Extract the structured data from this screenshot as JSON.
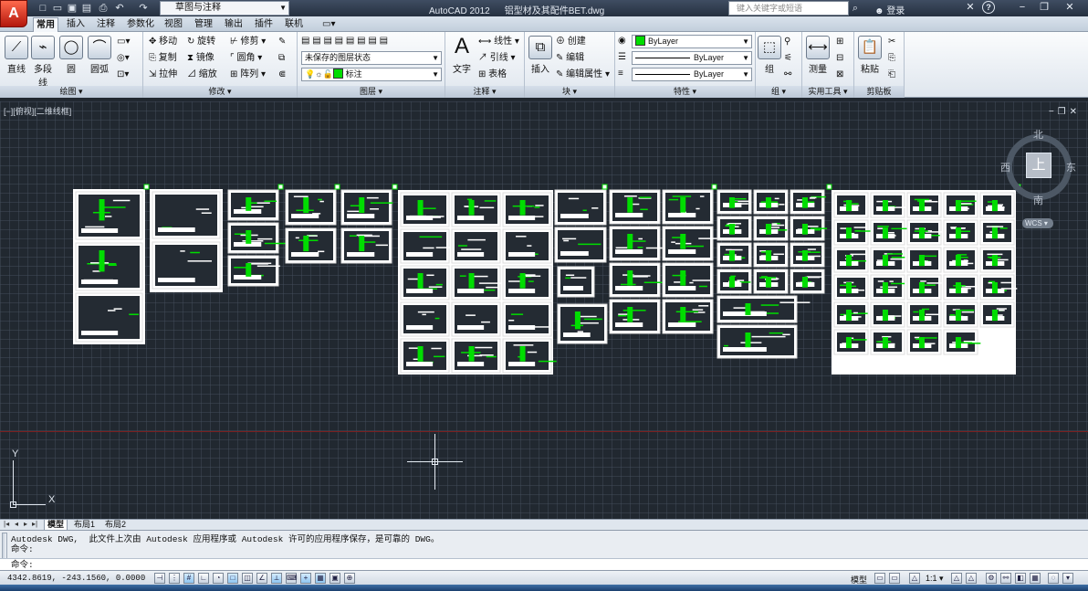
{
  "app": {
    "logo": "A",
    "title": "AutoCAD 2012",
    "file": "铝型材及其配件BET.dwg"
  },
  "quick_access": [
    "new-icon",
    "open-icon",
    "save-icon",
    "saveas-icon",
    "print-icon",
    "undo-icon",
    "redo-icon"
  ],
  "workspace": "草图与注释",
  "search": {
    "placeholder": "键入关键字或短语"
  },
  "user": {
    "login": "登录"
  },
  "help": "?",
  "ribbon_tabs": [
    {
      "label": "常用",
      "active": true
    },
    {
      "label": "插入"
    },
    {
      "label": "注释"
    },
    {
      "label": "参数化"
    },
    {
      "label": "视图"
    },
    {
      "label": "管理"
    },
    {
      "label": "输出"
    },
    {
      "label": "插件"
    },
    {
      "label": "联机"
    }
  ],
  "panels": {
    "draw": {
      "title": "绘图",
      "big": [
        "直线",
        "多段线",
        "圆",
        "圆弧"
      ]
    },
    "modify": {
      "title": "修改",
      "tools": [
        "移动",
        "旋转",
        "修剪",
        "复制",
        "镜像",
        "圆角",
        "拉伸",
        "缩放",
        "阵列"
      ]
    },
    "layers": {
      "title": "图层",
      "state": "未保存的图层状态",
      "current": "标注"
    },
    "annotation": {
      "title": "注释",
      "big": "文字",
      "tools": [
        "线性",
        "引线",
        "表格"
      ]
    },
    "block": {
      "title": "块",
      "big": "插入",
      "tools": [
        "创建",
        "编辑",
        "编辑属性"
      ]
    },
    "properties": {
      "title": "特性",
      "color": "ByLayer",
      "linetype": "ByLayer",
      "lineweight": "ByLayer"
    },
    "groups": {
      "title": "组",
      "big": "组"
    },
    "utilities": {
      "title": "实用工具",
      "big": "测量"
    },
    "clipboard": {
      "title": "剪贴板",
      "big": "粘贴"
    }
  },
  "viewport": {
    "label": "[−][俯视][二维线框]"
  },
  "viewcube": {
    "top": "上",
    "north": "北",
    "south": "南",
    "east": "东",
    "west": "西",
    "wcs": "WCS"
  },
  "ucs": {
    "x": "X",
    "y": "Y"
  },
  "layout_tabs": [
    {
      "label": "模型",
      "active": true
    },
    {
      "label": "布局1"
    },
    {
      "label": "布局2"
    }
  ],
  "command": {
    "history": [
      "Autodesk DWG,  此文件上次由 Autodesk 应用程序或 Autodesk 许可的应用程序保存，是可靠的 DWG。",
      "命令:"
    ],
    "prompt": "命令:"
  },
  "status": {
    "coords": "4342.8619, -243.1560, 0.0000",
    "model": "模型",
    "scale": "1:1"
  },
  "colors": {
    "canvas": "#212830",
    "accent_green": "#00dd00",
    "title_bar": "#2f3b4c"
  }
}
